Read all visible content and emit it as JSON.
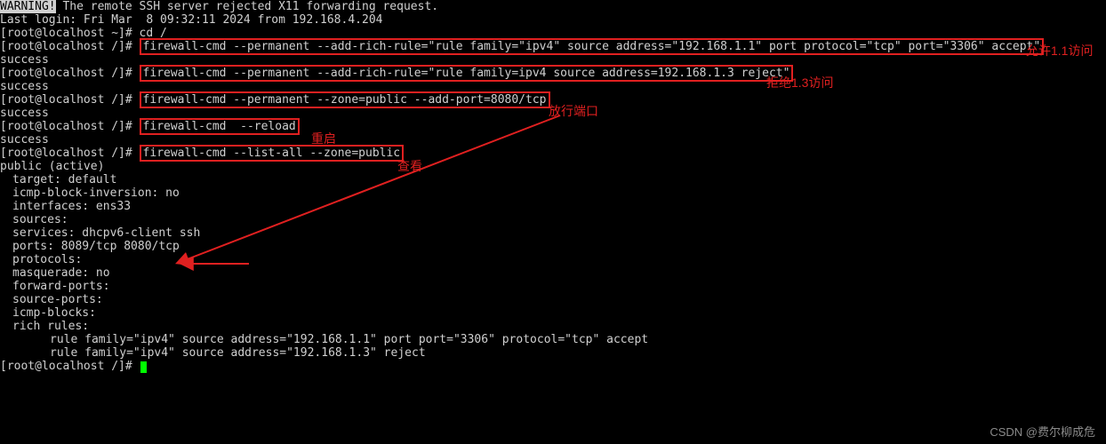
{
  "colors": {
    "accent": "#e02020",
    "bg": "#000000",
    "fg": "#d0d0d0",
    "cursor": "#00ff00"
  },
  "warning": {
    "label": "WARNING!",
    "text": " The remote SSH server rejected X11 forwarding request."
  },
  "last_login": "Last login: Fri Mar  8 09:32:11 2024 from 192.168.4.204",
  "prompts": {
    "home": "[root@localhost ~]# ",
    "root": "[root@localhost /]# "
  },
  "cmds": {
    "cd": "cd /",
    "rule1": "firewall-cmd --permanent --add-rich-rule=\"rule family=\"ipv4\" source address=\"192.168.1.1\" port protocol=\"tcp\" port=\"3306\" accept\"",
    "rule2": "firewall-cmd --permanent --add-rich-rule=\"rule family=ipv4 source address=192.168.1.3 reject\"",
    "addport": "firewall-cmd --permanent --zone=public --add-port=8080/tcp",
    "reload": "firewall-cmd  --reload",
    "listall": "firewall-cmd --list-all --zone=public"
  },
  "results": {
    "success": "success"
  },
  "list": {
    "zone": "public (active)",
    "target": "target: default",
    "icmp_inv": "icmp-block-inversion: no",
    "ifaces": "interfaces: ens33",
    "sources": "sources:",
    "services": "services: dhcpv6-client ssh",
    "ports": "ports: 8089/tcp 8080/tcp",
    "protocols": "protocols:",
    "masq": "masquerade: no",
    "fwd": "forward-ports:",
    "srcports": "source-ports:",
    "icmp": "icmp-blocks:",
    "rich": "rich rules:",
    "rich1": "rule family=\"ipv4\" source address=\"192.168.1.1\" port port=\"3306\" protocol=\"tcp\" accept",
    "rich2": "rule family=\"ipv4\" source address=\"192.168.1.3\" reject"
  },
  "annotations": {
    "allow11": "允许1.1访问",
    "reject13": "拒绝1.3访问",
    "openport": "放行端口",
    "reload": "重启",
    "view": "查看"
  },
  "watermark": "CSDN @费尔柳成危"
}
